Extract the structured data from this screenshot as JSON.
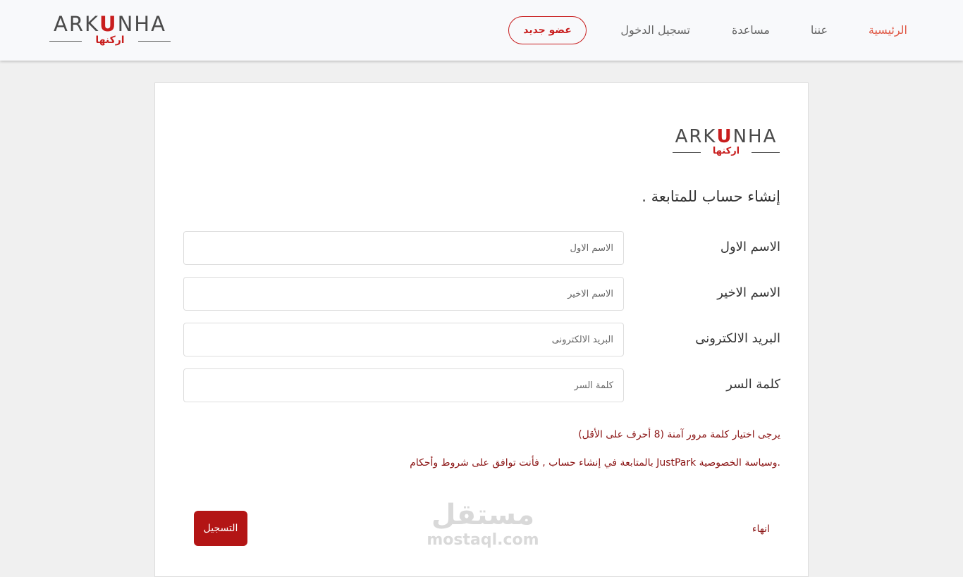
{
  "colors": {
    "accent": "#c81e1e",
    "active_nav": "#e05a47",
    "note_text": "#8b1515",
    "submit_bg": "#b31515",
    "page_bg": "#f0f0f0"
  },
  "logo": {
    "latin_text": "ARKUNHA",
    "arabic_text": "اركنها"
  },
  "nav": {
    "items": [
      {
        "label": "الرئيسية",
        "active": true
      },
      {
        "label": "عننا",
        "active": false
      },
      {
        "label": "مساعدة",
        "active": false
      },
      {
        "label": "تسجيل الدخول",
        "active": false
      }
    ],
    "register_label": "عضو جديد"
  },
  "form": {
    "title": "إنشاء حساب للمتابعة .",
    "fields": [
      {
        "label": "الاسم الاول",
        "placeholder": "الاسم الاول",
        "value": ""
      },
      {
        "label": "الاسم الاخير",
        "placeholder": "الاسم الاخير",
        "value": ""
      },
      {
        "label": "البريد الالكترونى",
        "placeholder": "البريد الالكترونى",
        "value": ""
      },
      {
        "label": "كلمة السر",
        "placeholder": "كلمة السر",
        "value": ""
      }
    ],
    "password_hint": "يرجى اختيار كلمة مرور آمنة (8 أحرف على الأقل)",
    "terms_text": ".وسياسة الخصوصية JustPark بالمتابعة في إنشاء حساب , فأنت توافق على شروط وأحكام",
    "finish_label": "انهاء",
    "submit_label": "التسجيل"
  },
  "watermark": {
    "arabic": "مستقل",
    "latin": "mostaql.com"
  }
}
